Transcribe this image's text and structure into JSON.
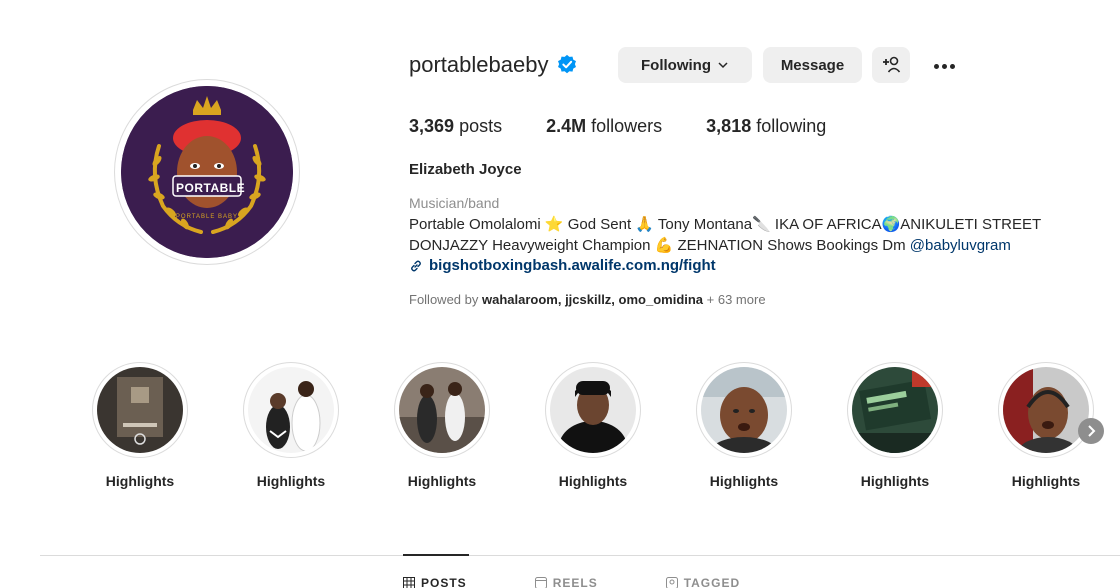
{
  "profile": {
    "username": "portablebaeby",
    "verified": true,
    "avatar_text": "PORTABLE",
    "avatar_subtext": "PORTABLE BABY"
  },
  "actions": {
    "following_label": "Following",
    "message_label": "Message"
  },
  "stats": {
    "posts_count": "3,369",
    "posts_label": "posts",
    "followers_count": "2.4M",
    "followers_label": "followers",
    "following_count": "3,818",
    "following_label": "following"
  },
  "bio": {
    "full_name": "Elizabeth Joyce",
    "category": "Musician/band",
    "line1": "Portable Omolalomi ⭐ God Sent 🙏 Tony Montana🔪 IKA OF AFRICA🌍ANIKULETI STREET",
    "line2_text": "DONJAZZY Heavyweight Champion 💪 ZEHNATION Shows Bookings Dm ",
    "line2_mention": "@babyluvgram",
    "link": "bigshotboxingbash.awalife.com.ng/fight"
  },
  "followed_by": {
    "prefix": "Followed by ",
    "names": "wahalaroom, jjcskillz, omo_omidina",
    "suffix": " + 63 more"
  },
  "highlights": [
    {
      "label": "Highlights"
    },
    {
      "label": "Highlights"
    },
    {
      "label": "Highlights"
    },
    {
      "label": "Highlights"
    },
    {
      "label": "Highlights"
    },
    {
      "label": "Highlights"
    },
    {
      "label": "Highlights"
    }
  ],
  "tabs": [
    {
      "label": "POSTS",
      "active": true
    },
    {
      "label": "REELS",
      "active": false
    },
    {
      "label": "TAGGED",
      "active": false
    }
  ],
  "colors": {
    "verified_blue": "#0095f6",
    "link_blue": "#00376b",
    "button_bg": "#efefef",
    "avatar_bg": "#3b1d4f",
    "gold": "#d9a520"
  }
}
